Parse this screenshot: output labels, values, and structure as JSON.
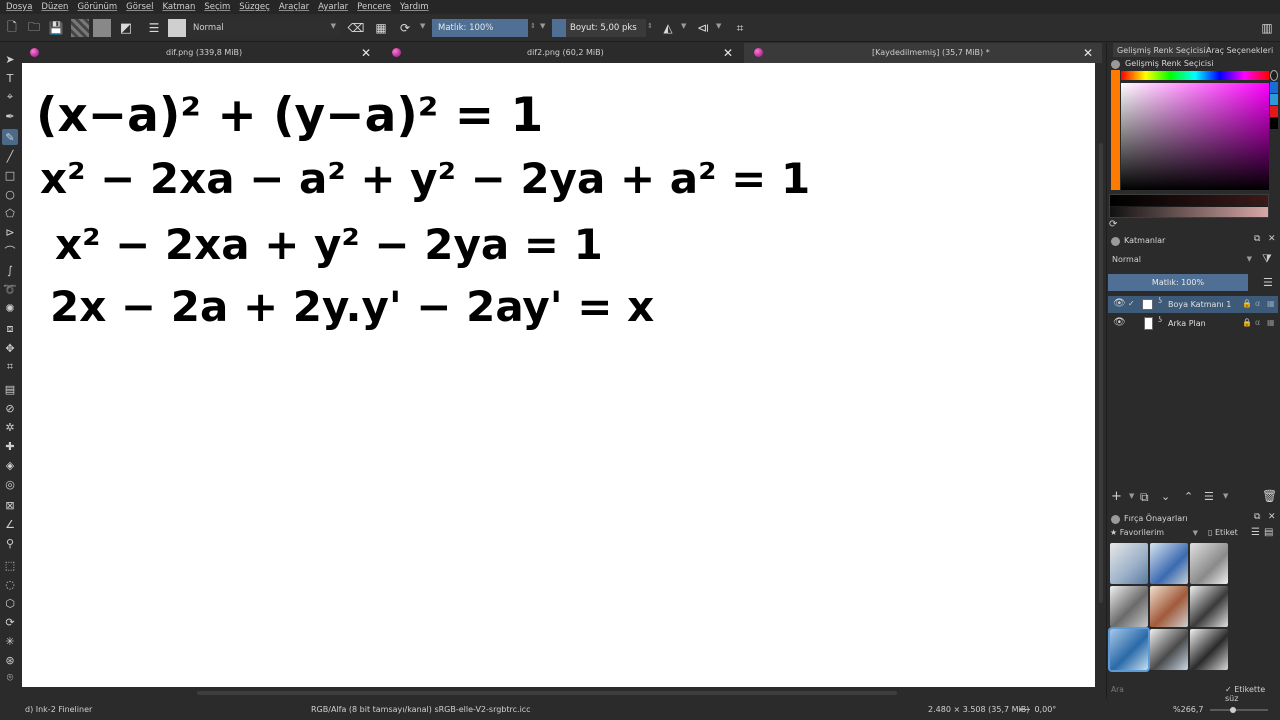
{
  "menu": [
    "Dosya",
    "Düzen",
    "Görünüm",
    "Görsel",
    "Katman",
    "Seçim",
    "Süzgeç",
    "Araçlar",
    "Ayarlar",
    "Pencere",
    "Yardım"
  ],
  "toolbar": {
    "blend_mode": "Normal",
    "opacity_label": "Matlık: 100%",
    "size_label": "Boyut: 5,00 pks"
  },
  "tabs": [
    {
      "title": "dif.png (339,8 MiB)"
    },
    {
      "title": "dif2.png (60,2 MiB)"
    },
    {
      "title": "[Kaydedilmemiş]  (35,7 MiB) *"
    }
  ],
  "canvas": {
    "equations": [
      "(x−a)² + (y−a)² = 1",
      "x² − 2xa − a² + y² − 2ya + a² = 1",
      "x² − 2xa + y² − 2ya = 1",
      "2x − 2a + 2y.y' − 2ay' = x"
    ]
  },
  "dock": {
    "tab_color_selector": "Gelişmiş Renk Seçicisi",
    "tab_tool_options": "Araç Seçenekleri",
    "color_panel_title": "Gelişmiş Renk Seçicisi",
    "layers_title": "Katmanlar",
    "layers_blend": "Normal",
    "layers_opacity": "Matlık:  100%",
    "layers": [
      {
        "name": "Boya Katmanı 1",
        "selected": true
      },
      {
        "name": "Arka Plan",
        "selected": false
      }
    ],
    "brush_presets_title": "Fırça Önayarları",
    "favorites_label": "Favorilerim",
    "tag_label": "Etiket",
    "search_placeholder": "Ara",
    "filter_by_tag_label": "Etikette süz"
  },
  "status": {
    "brush": "d) Ink-2 Fineliner",
    "color_profile": "RGB/Alfa (8 bit tamsayı/kanal)  sRGB-elle-V2-srgbtrc.icc",
    "image_size": "2.480 × 3.508 (35,7 MiB)",
    "rotation": "0,00°",
    "zoom": "%266,7"
  },
  "colors": {
    "accent": "#3d5a78",
    "foreground": "#ff7a00",
    "background": "#2b2b2b"
  }
}
